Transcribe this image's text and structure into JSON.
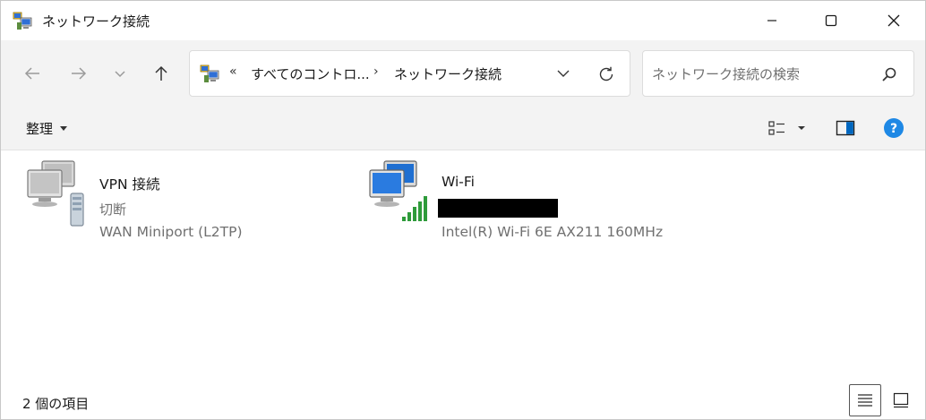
{
  "window": {
    "title": "ネットワーク接続"
  },
  "address": {
    "overflow": "«",
    "crumbs": [
      "すべてのコントロ...",
      "ネットワーク接続"
    ],
    "separator": "›"
  },
  "search": {
    "placeholder": "ネットワーク接続の検索"
  },
  "toolbar": {
    "organize_label": "整理"
  },
  "connections": [
    {
      "name": "VPN 接続",
      "status": "切断",
      "device": "WAN Miniport (L2TP)",
      "icon": "vpn-connection-icon"
    },
    {
      "name": "Wi-Fi",
      "status": "",
      "device": "Intel(R) Wi-Fi 6E AX211 160MHz",
      "icon": "wifi-connection-icon",
      "status_redacted": true
    }
  ],
  "statusbar": {
    "count": "2 個の項目"
  },
  "colors": {
    "accent": "#0067c0",
    "help": "#1e88e5",
    "signal": "#2e9b3a",
    "monitor_screen": "#1f6fd1"
  }
}
